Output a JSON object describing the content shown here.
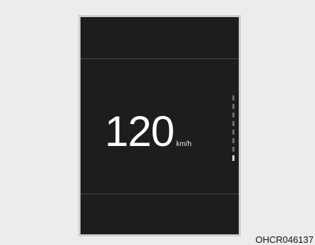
{
  "display": {
    "speed_value": "120",
    "speed_unit": "km/h"
  },
  "figure": {
    "code": "OHCR046137"
  },
  "scale": {
    "tick_count": 8,
    "active_tick_index": 7
  },
  "colors": {
    "page_background": "#ececec",
    "screen_background": "#1d1d1d",
    "frame": "#cfcfcf",
    "text": "#ffffff"
  }
}
